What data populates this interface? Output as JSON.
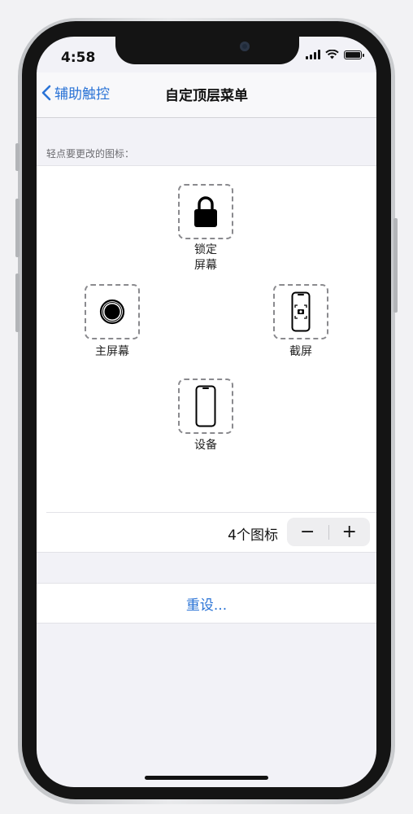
{
  "status_bar": {
    "time": "4:58"
  },
  "nav": {
    "back_label": "辅助触控",
    "title": "自定顶层菜单"
  },
  "section_header": "轻点要更改的图标：",
  "icons": {
    "top": {
      "label_line1": "锁定",
      "label_line2": "屏幕",
      "icon": "lock-icon"
    },
    "left": {
      "label": "主屏幕",
      "icon": "home-button-icon"
    },
    "right": {
      "label": "截屏",
      "icon": "screenshot-icon"
    },
    "bottom": {
      "label": "设备",
      "icon": "iphone-device-icon"
    }
  },
  "stepper": {
    "count_label": "4个图标",
    "minus": "−",
    "plus": "+"
  },
  "reset": {
    "label": "重设..."
  },
  "colors": {
    "accent": "#2a73d6",
    "background": "#f2f2f7"
  }
}
